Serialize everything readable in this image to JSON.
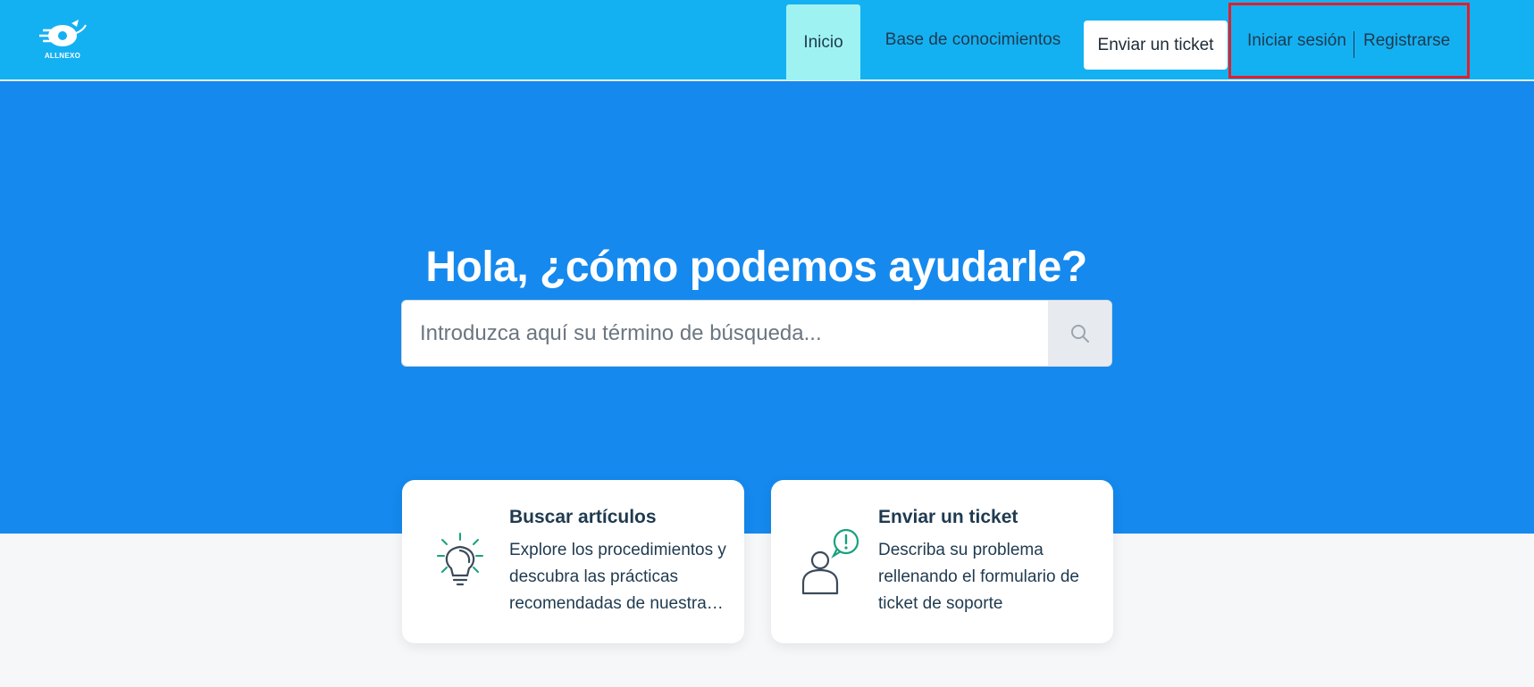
{
  "brand": {
    "logo_text": "ALLNEXO"
  },
  "nav": {
    "inicio": "Inicio",
    "base": "Base de conocimientos",
    "ticket": "Enviar un ticket",
    "login": "Iniciar sesión",
    "register": "Registrarse"
  },
  "hero": {
    "title": "Hola, ¿cómo podemos ayudarle?",
    "search_placeholder": "Introduzca aquí su término de búsqueda..."
  },
  "cards": [
    {
      "title": "Buscar artículos",
      "description": "Explore los procedimientos y descubra las prácticas recomendadas de nuestra base de conocimientos",
      "icon": "lightbulb-icon"
    },
    {
      "title": "Enviar un ticket",
      "description": "Describa su problema rellenando el formulario de ticket de soporte",
      "icon": "user-alert-icon"
    }
  ],
  "colors": {
    "header_bg": "#14b1f2",
    "hero_bg": "#1589ee",
    "active_tab": "#9ef3f2",
    "highlight_border": "#e0202a",
    "icon_accent": "#1aa17e",
    "icon_dark": "#3b4a5a"
  }
}
